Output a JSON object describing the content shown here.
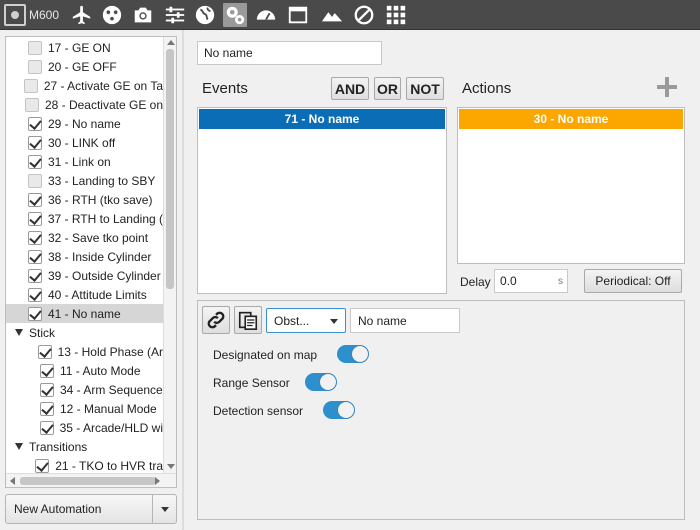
{
  "toolbar": {
    "device_label": "M600",
    "icons": [
      "chip-icon",
      "airplane-icon",
      "dots-icon",
      "camera-icon",
      "sliders-icon",
      "globe-icon",
      "gears-icon",
      "gauge-icon",
      "window-icon",
      "mountain-icon",
      "prohibit-icon",
      "grid-icon"
    ],
    "active": "gears-icon"
  },
  "tree": {
    "items": [
      {
        "label": "17 - GE ON",
        "checked": false
      },
      {
        "label": "20 - GE OFF",
        "checked": false
      },
      {
        "label": "27 - Activate GE on Ta",
        "checked": false
      },
      {
        "label": "28 - Deactivate GE on",
        "checked": false
      },
      {
        "label": "29 - No name",
        "checked": true
      },
      {
        "label": "30 - LINK off",
        "checked": true
      },
      {
        "label": "31 - Link on",
        "checked": true
      },
      {
        "label": "33 - Landing to SBY",
        "checked": false
      },
      {
        "label": "36 - RTH (tko save)",
        "checked": true
      },
      {
        "label": "37 - RTH to Landing (",
        "checked": true
      },
      {
        "label": "32 - Save tko point",
        "checked": true
      },
      {
        "label": "38 - Inside Cylinder",
        "checked": true
      },
      {
        "label": "39 - Outside Cylinder",
        "checked": true
      },
      {
        "label": "40 - Attitude Limits",
        "checked": true
      },
      {
        "label": "41 - No name",
        "checked": true,
        "selected": true
      }
    ],
    "group_stick": "Stick",
    "stick_items": [
      {
        "label": "13 - Hold Phase (Ar",
        "checked": true
      },
      {
        "label": "11 - Auto Mode",
        "checked": true
      },
      {
        "label": "34 - Arm Sequence",
        "checked": true
      },
      {
        "label": "12 - Manual Mode",
        "checked": true
      },
      {
        "label": "35 - Arcade/HLD wi",
        "checked": true
      }
    ],
    "group_transitions": "Transitions",
    "transition_items": [
      {
        "label": "21 - TKO to HVR tra",
        "checked": true
      }
    ]
  },
  "new_automation": "New Automation",
  "name_field": "No name",
  "events": {
    "title": "Events",
    "and": "AND",
    "or": "OR",
    "not": "NOT",
    "item": "71 - No name",
    "item_color": "#0a6db5"
  },
  "actions": {
    "title": "Actions",
    "item": "30 - No name",
    "item_color": "#fca600",
    "delay_label": "Delay",
    "delay_value": "0.0",
    "delay_unit": "s",
    "periodical": "Periodical: Off"
  },
  "detail": {
    "type_select": "Obst...",
    "name": "No name",
    "options": [
      {
        "label": "Designated on map",
        "on": true
      },
      {
        "label": "Range Sensor",
        "on": true
      },
      {
        "label": "Detection sensor",
        "on": true
      }
    ]
  }
}
